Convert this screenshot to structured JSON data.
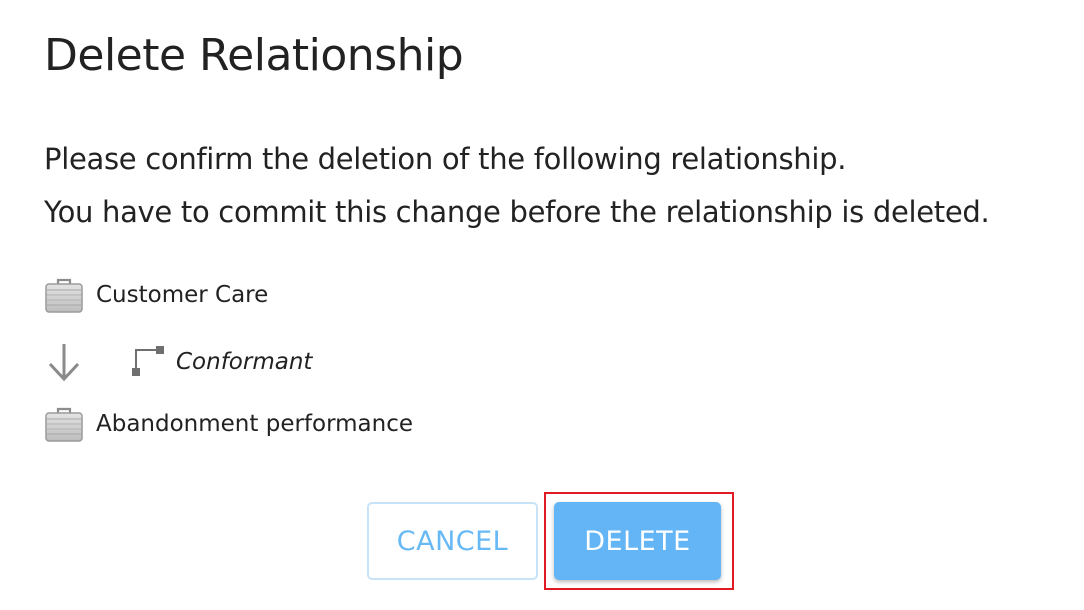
{
  "dialog": {
    "title": "Delete Relationship",
    "message_line1": "Please confirm the deletion of the following relationship.",
    "message_line2": "You have to commit this change before the relationship is deleted."
  },
  "relationship": {
    "source": {
      "label": "Customer Care",
      "icon": "briefcase-icon"
    },
    "relation": {
      "label": "Conformant",
      "icon": "relationship-connector-icon",
      "direction_icon": "arrow-down-icon"
    },
    "target": {
      "label": "Abandonment performance",
      "icon": "briefcase-icon"
    }
  },
  "buttons": {
    "cancel_label": "CANCEL",
    "delete_label": "DELETE"
  },
  "colors": {
    "accent": "#64b5f6",
    "highlight": "#e01b24"
  }
}
